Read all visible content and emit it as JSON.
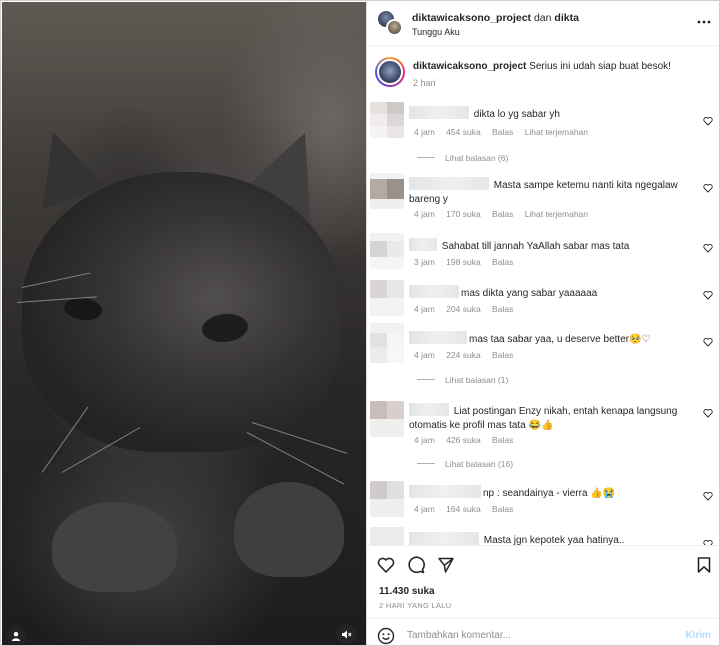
{
  "header": {
    "username": "diktawicaksono_project",
    "joiner": "dan",
    "collaborator": "dikta",
    "subtitle": "Tunggu Aku"
  },
  "caption": {
    "username": "diktawicaksono_project",
    "text": "Serius ini udah siap buat besok!",
    "time": "2 hari"
  },
  "comments": [
    {
      "text": "dikta lo yg sabar yh",
      "time": "4 jam",
      "likes": "454 suka",
      "reply": "Balas",
      "translate": "Lihat terjemahan",
      "replies": "Lihat balasan (6)"
    },
    {
      "text": "Masta sampe ketemu nanti kita ngegalaw bareng y",
      "time": "4 jam",
      "likes": "170 suka",
      "reply": "Balas",
      "translate": "Lihat terjemahan"
    },
    {
      "text": "Sahabat till jannah YaAllah sabar mas tata",
      "time": "3 jam",
      "likes": "198 suka",
      "reply": "Balas"
    },
    {
      "text": "mas dikta yang sabar yaaaaaa",
      "time": "4 jam",
      "likes": "204 suka",
      "reply": "Balas"
    },
    {
      "text": "mas taa sabar yaa, u deserve better🥺♡",
      "time": "4 jam",
      "likes": "224 suka",
      "reply": "Balas",
      "replies": "Lihat balasan (1)"
    },
    {
      "text": "Liat postingan Enzy nikah, entah kenapa langsung otomatis ke profil mas tata 😂👍",
      "time": "4 jam",
      "likes": "426 suka",
      "reply": "Balas",
      "replies": "Lihat balasan (16)"
    },
    {
      "text": "np : seandainya - vierra 👍😭",
      "time": "4 jam",
      "likes": "164 suka",
      "reply": "Balas"
    },
    {
      "text": "Masta jgn kepotek yaa hatinya.."
    }
  ],
  "footer": {
    "likes": "11.430 suka",
    "date": "2 HARI YANG LALU",
    "comment_placeholder": "Tambahkan komentar...",
    "send": "Kirim"
  },
  "icons": {
    "more": "more-horizontal-icon",
    "like": "heart-icon",
    "comment": "comment-icon",
    "share": "send-icon",
    "save": "bookmark-icon",
    "emoji": "emoji-icon",
    "mute": "speaker-muted-icon",
    "user": "user-tag-icon"
  },
  "colors": {
    "text": "#262626",
    "muted": "#8e8e8e",
    "send_disabled": "#b3dbff"
  }
}
